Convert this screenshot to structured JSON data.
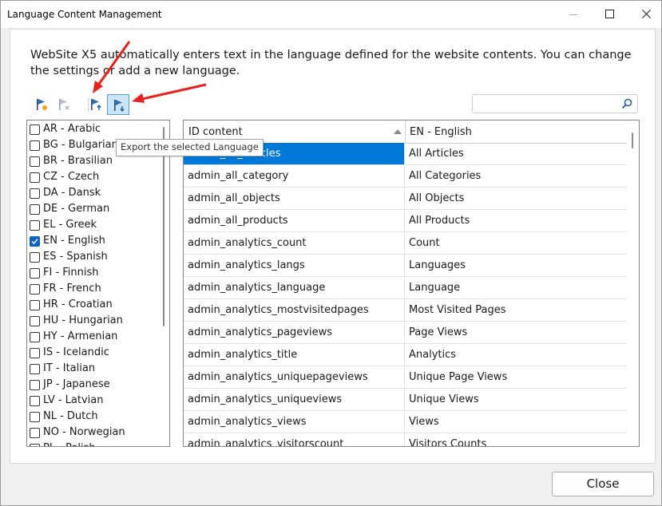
{
  "window": {
    "title": "Language Content Management"
  },
  "description": "WebSite X5 automatically enters text in the language defined for the website contents. You can change the settings or add a new language.",
  "toolbar": {
    "buttons": [
      {
        "icon": "flag-add-icon",
        "state": "normal"
      },
      {
        "icon": "flag-remove-icon",
        "state": "disabled"
      },
      {
        "icon": "flag-import-icon",
        "state": "normal"
      },
      {
        "icon": "flag-export-icon",
        "state": "active"
      }
    ]
  },
  "search": {
    "placeholder": "",
    "value": ""
  },
  "languages": [
    {
      "label": "AR - Arabic",
      "checked": false
    },
    {
      "label": "BG - Bulgarian",
      "checked": false
    },
    {
      "label": "BR - Brasilian",
      "checked": false
    },
    {
      "label": "CZ - Czech",
      "checked": false
    },
    {
      "label": "DA - Dansk",
      "checked": false
    },
    {
      "label": "DE - German",
      "checked": false
    },
    {
      "label": "EL - Greek",
      "checked": false
    },
    {
      "label": "EN - English",
      "checked": true
    },
    {
      "label": "ES - Spanish",
      "checked": false
    },
    {
      "label": "FI - Finnish",
      "checked": false
    },
    {
      "label": "FR - French",
      "checked": false
    },
    {
      "label": "HR - Croatian",
      "checked": false
    },
    {
      "label": "HU - Hungarian",
      "checked": false
    },
    {
      "label": "HY - Armenian",
      "checked": false
    },
    {
      "label": "IS - Icelandic",
      "checked": false
    },
    {
      "label": "IT - Italian",
      "checked": false
    },
    {
      "label": "JP - Japanese",
      "checked": false
    },
    {
      "label": "LV - Latvian",
      "checked": false
    },
    {
      "label": "NL - Dutch",
      "checked": false
    },
    {
      "label": "NO - Norwegian",
      "checked": false
    },
    {
      "label": "PL - Polish",
      "checked": false
    }
  ],
  "grid": {
    "columns": [
      "ID content",
      "EN - English"
    ],
    "rows": [
      [
        "admin_all_articles",
        "All Articles"
      ],
      [
        "admin_all_category",
        "All Categories"
      ],
      [
        "admin_all_objects",
        "All Objects"
      ],
      [
        "admin_all_products",
        "All Products"
      ],
      [
        "admin_analytics_count",
        "Count"
      ],
      [
        "admin_analytics_langs",
        "Languages"
      ],
      [
        "admin_analytics_language",
        "Language"
      ],
      [
        "admin_analytics_mostvisitedpages",
        "Most Visited Pages"
      ],
      [
        "admin_analytics_pageviews",
        "Page Views"
      ],
      [
        "admin_analytics_title",
        "Analytics"
      ],
      [
        "admin_analytics_uniquepageviews",
        "Unique Page Views"
      ],
      [
        "admin_analytics_uniqueviews",
        "Unique Views"
      ],
      [
        "admin_analytics_views",
        "Views"
      ],
      [
        "admin_analytics_visitorscount",
        "Visitors Counts"
      ]
    ],
    "selected_row": 0
  },
  "tooltip": "Export the selected Language",
  "close_label": "Close",
  "colors": {
    "accent": "#0078d7",
    "arrow": "#e8201e",
    "active_tool": "#cce4f7"
  }
}
